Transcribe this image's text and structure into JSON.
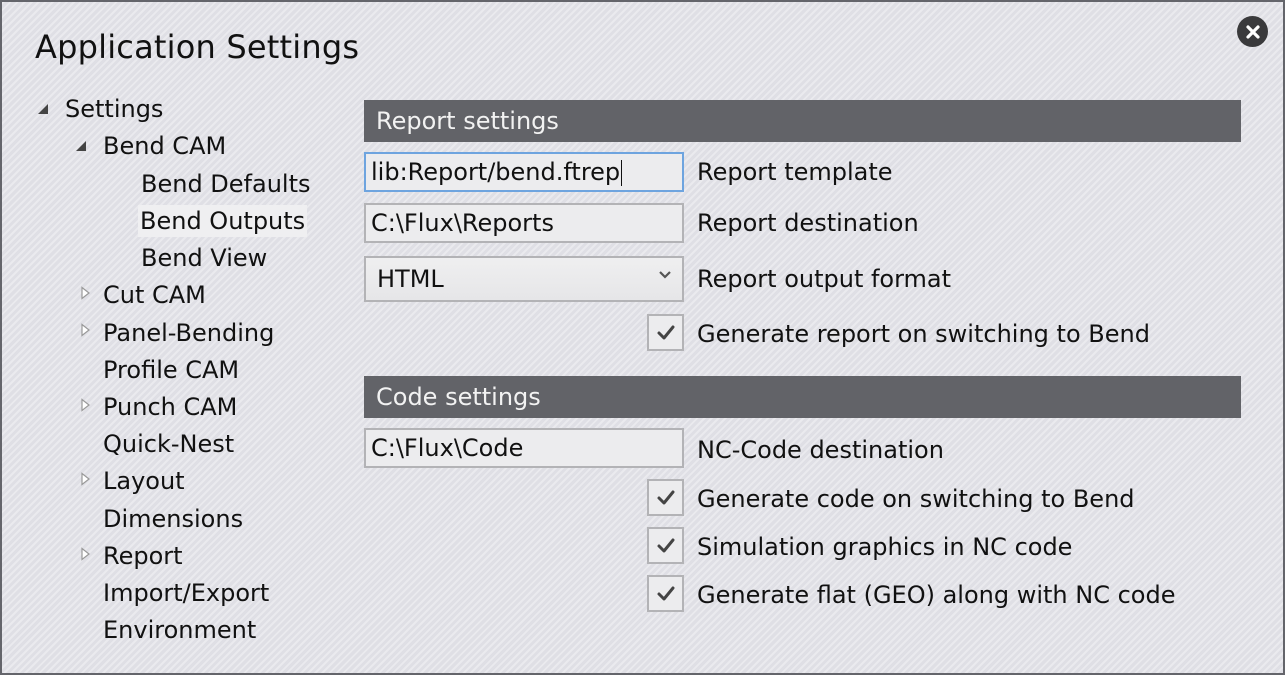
{
  "dialog": {
    "title": "Application Settings",
    "close_icon": "close-icon"
  },
  "tree": {
    "items": [
      {
        "label": "Settings",
        "level": 0,
        "expander": "expanded"
      },
      {
        "label": "Bend CAM",
        "level": 1,
        "expander": "expanded"
      },
      {
        "label": "Bend Defaults",
        "level": 2,
        "expander": "none"
      },
      {
        "label": "Bend Outputs",
        "level": 2,
        "expander": "none",
        "selected": true
      },
      {
        "label": "Bend View",
        "level": 2,
        "expander": "none"
      },
      {
        "label": "Cut CAM",
        "level": 1,
        "expander": "collapsed"
      },
      {
        "label": "Panel-Bending",
        "level": 1,
        "expander": "collapsed"
      },
      {
        "label": "Profile CAM",
        "level": 1,
        "expander": "none"
      },
      {
        "label": "Punch CAM",
        "level": 1,
        "expander": "collapsed"
      },
      {
        "label": "Quick-Nest",
        "level": 1,
        "expander": "none"
      },
      {
        "label": "Layout",
        "level": 1,
        "expander": "collapsed"
      },
      {
        "label": "Dimensions",
        "level": 1,
        "expander": "none"
      },
      {
        "label": "Report",
        "level": 1,
        "expander": "collapsed"
      },
      {
        "label": "Import/Export",
        "level": 1,
        "expander": "none"
      },
      {
        "label": "Environment",
        "level": 1,
        "expander": "none"
      }
    ]
  },
  "report_settings": {
    "header": "Report settings",
    "template": {
      "value": "lib:Report/bend.ftrep",
      "label": "Report template"
    },
    "destination": {
      "value": "C:\\Flux\\Reports",
      "label": "Report destination"
    },
    "output_format": {
      "value": "HTML",
      "label": "Report output format"
    },
    "generate_on_switch": {
      "checked": true,
      "label": "Generate report on switching to Bend"
    }
  },
  "code_settings": {
    "header": "Code settings",
    "destination": {
      "value": "C:\\Flux\\Code",
      "label": "NC-Code destination"
    },
    "checkboxes": [
      {
        "checked": true,
        "label": "Generate code on switching to Bend"
      },
      {
        "checked": true,
        "label": "Simulation graphics in NC code"
      },
      {
        "checked": true,
        "label": "Generate flat (GEO) along with NC code"
      }
    ]
  },
  "colors": {
    "section_header_bg": "#626368",
    "focus_border": "#6ea4df",
    "dialog_bg": "#dfdfe5",
    "selected_item_bg": "#efeff1"
  }
}
